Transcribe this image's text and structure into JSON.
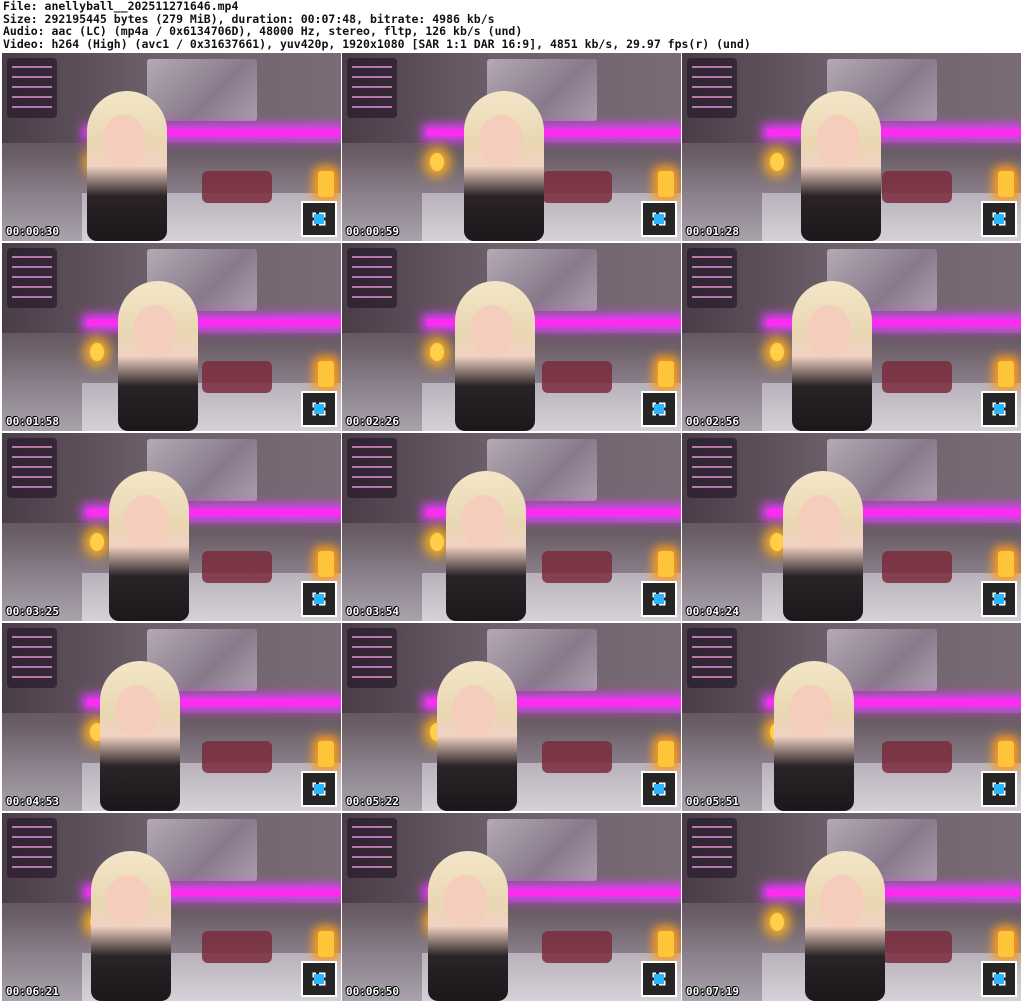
{
  "header": {
    "line1": "File: anellyball__202511271646.mp4",
    "line2": "Size: 292195445 bytes (279 MiB), duration: 00:07:48, bitrate: 4986 kb/s",
    "line3": "Audio: aac (LC) (mp4a / 0x6134706D), 48000 Hz, stereo, fltp, 126 kb/s (und)",
    "line4": "Video: h264 (High) (avc1 / 0x31637661), yuv420p, 1920x1080 [SAR 1:1 DAR 16:9], 4851 kb/s, 29.97 fps(r) (und)"
  },
  "thumbnails": [
    {
      "timestamp": "00:00:30"
    },
    {
      "timestamp": "00:00:59"
    },
    {
      "timestamp": "00:01:28"
    },
    {
      "timestamp": "00:01:58"
    },
    {
      "timestamp": "00:02:26"
    },
    {
      "timestamp": "00:02:56"
    },
    {
      "timestamp": "00:03:25"
    },
    {
      "timestamp": "00:03:54"
    },
    {
      "timestamp": "00:04:24"
    },
    {
      "timestamp": "00:04:53"
    },
    {
      "timestamp": "00:05:22"
    },
    {
      "timestamp": "00:05:51"
    },
    {
      "timestamp": "00:06:21"
    },
    {
      "timestamp": "00:06:50"
    },
    {
      "timestamp": "00:07:19"
    }
  ],
  "colors": {
    "neon": "#ff2bf0",
    "lamp": "#ffc53a",
    "timestamp_text": "#ffffff"
  }
}
